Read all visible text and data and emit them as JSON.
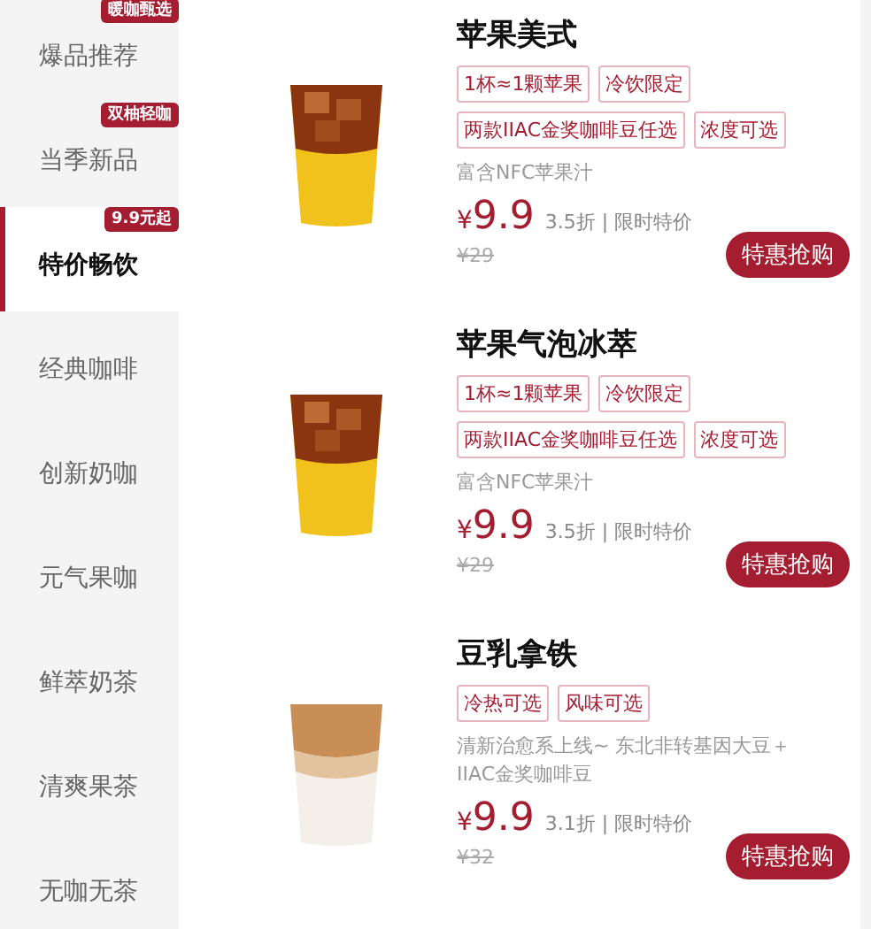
{
  "categories": [
    {
      "label": "爆品推荐",
      "badge": "暖咖甄选",
      "selected": false
    },
    {
      "label": "当季新品",
      "badge": "双柚轻咖",
      "selected": false
    },
    {
      "label": "特价畅饮",
      "badge": "9.9元起",
      "selected": true
    },
    {
      "label": "经典咖啡",
      "selected": false
    },
    {
      "label": "创新奶咖",
      "selected": false
    },
    {
      "label": "元气果咖",
      "selected": false
    },
    {
      "label": "鲜萃奶茶",
      "selected": false
    },
    {
      "label": "清爽果茶",
      "selected": false
    },
    {
      "label": "无咖无茶",
      "selected": false
    }
  ],
  "products": [
    {
      "kind": "iced-layered",
      "name": "苹果美式",
      "tags": [
        "1杯≈1颗苹果",
        "冷饮限定",
        "两款IIAC金奖咖啡豆任选",
        "浓度可选"
      ],
      "description": "富含NFC苹果汁",
      "currency": "¥",
      "price": "9.9",
      "discount": "3.5折 | 限时特价",
      "original_price": "¥29",
      "button": "特惠抢购"
    },
    {
      "kind": "iced-layered",
      "name": "苹果气泡冰萃",
      "tags": [
        "1杯≈1颗苹果",
        "冷饮限定",
        "两款IIAC金奖咖啡豆任选",
        "浓度可选"
      ],
      "description": "富含NFC苹果汁",
      "currency": "¥",
      "price": "9.9",
      "discount": "3.5折 | 限时特价",
      "original_price": "¥29",
      "button": "特惠抢购"
    },
    {
      "kind": "latte",
      "name": "豆乳拿铁",
      "tags": [
        "冷热可选",
        "风味可选"
      ],
      "description": "清新治愈系上线~ 东北非转基因大豆＋IIAC金奖咖啡豆",
      "currency": "¥",
      "price": "9.9",
      "discount": "3.1折 | 限时特价",
      "original_price": "¥32",
      "button": "特惠抢购"
    }
  ]
}
